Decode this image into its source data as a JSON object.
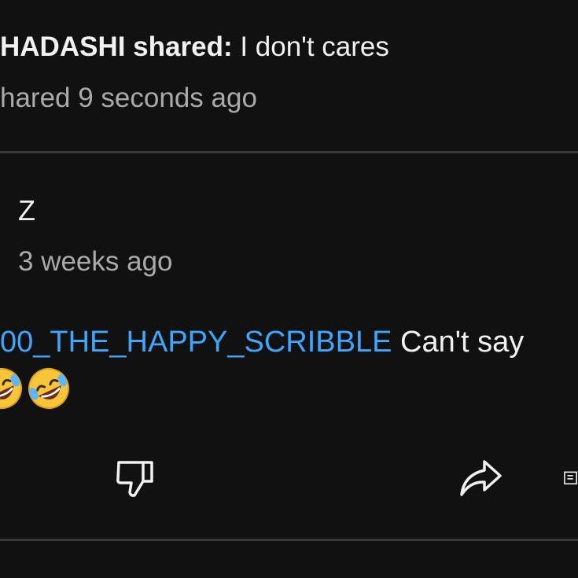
{
  "shared_post": {
    "author": "HADASHI shared:",
    "text": " I don't cares",
    "time": "hared 9 seconds ago"
  },
  "comment": {
    "author": "Z",
    "time": "3 weeks ago",
    "mention": "00_THE_HAPPY_SCRIBBLE",
    "text": " Can't say",
    "emoji": [
      "rolling-on-floor-laughing",
      "rolling-on-floor-laughing"
    ]
  },
  "actions": {
    "dislike_icon": "thumb-down-icon",
    "share_icon": "share-arrow-icon",
    "save_icon": "save-to-playlist-icon"
  },
  "colors": {
    "background": "#111111",
    "mention": "#3ea6ff",
    "secondary_text": "#aaaaaa",
    "divider": "#3a3a3a"
  }
}
